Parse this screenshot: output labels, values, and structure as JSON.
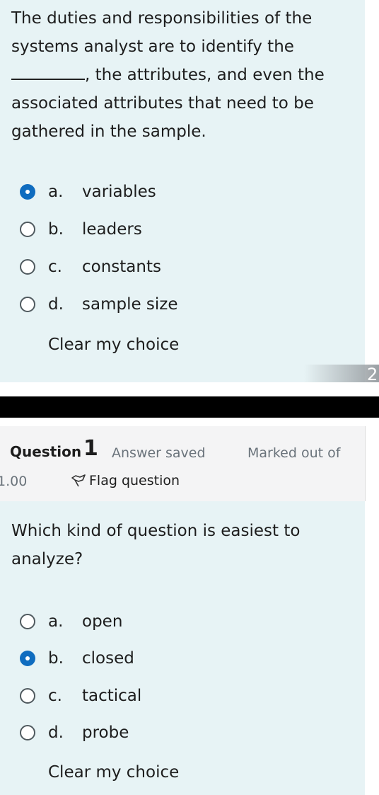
{
  "question_prev": {
    "text_before_blank": "The duties and responsibilities of the systems analyst are to identify the ",
    "text_after_blank": ", the attributes, and even the associated attributes that need to be gathered in the sample.",
    "options": [
      {
        "letter": "a.",
        "text": "variables",
        "checked": true
      },
      {
        "letter": "b.",
        "text": "leaders",
        "checked": false
      },
      {
        "letter": "c.",
        "text": "constants",
        "checked": false
      },
      {
        "letter": "d.",
        "text": "sample size",
        "checked": false
      }
    ],
    "clear_label": "Clear my choice",
    "next_number": "2"
  },
  "question_info": {
    "label": "Question",
    "number": "1",
    "state": "Answer saved",
    "marked": "Marked out of",
    "points": "1.00",
    "flag_label": "Flag question",
    "flag_icon": "flag-icon"
  },
  "question_current": {
    "text": "Which kind of question is easiest to analyze?",
    "options": [
      {
        "letter": "a.",
        "text": "open",
        "checked": false
      },
      {
        "letter": "b.",
        "text": "closed",
        "checked": true
      },
      {
        "letter": "c.",
        "text": "tactical",
        "checked": false
      },
      {
        "letter": "d.",
        "text": "probe",
        "checked": false
      }
    ],
    "clear_label": "Clear my choice"
  },
  "colors": {
    "panel": "#e7f3f5",
    "radio_checked": "#0f6cbf",
    "info_bg": "#f4f4f5"
  }
}
